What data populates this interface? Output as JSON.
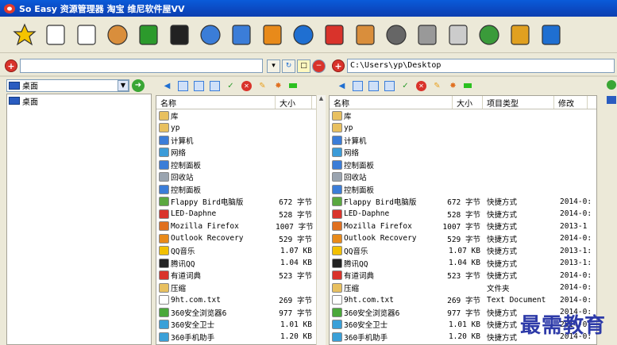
{
  "window": {
    "title": "So Easy 资源管理器  淘宝 维尼软件屋VV"
  },
  "toolbar": {
    "buttons": [
      {
        "icon": "star-icon",
        "color": "#f5c400"
      },
      {
        "icon": "document-icon",
        "color": "#ffffff"
      },
      {
        "icon": "edit-icon",
        "color": "#ffffff"
      },
      {
        "icon": "palette-icon",
        "color": "#d98e3c"
      },
      {
        "icon": "notepad-icon",
        "color": "#2c9a2c"
      },
      {
        "icon": "cmd-icon",
        "color": "#222222"
      },
      {
        "icon": "monitor-icon",
        "color": "#3b7dd8"
      },
      {
        "icon": "users-icon",
        "color": "#3b7dd8"
      },
      {
        "icon": "folder-icon",
        "color": "#e88a1a"
      },
      {
        "icon": "ie-icon",
        "color": "#1f6fd1"
      },
      {
        "icon": "home-icon",
        "color": "#d9332b"
      },
      {
        "icon": "recycle-icon",
        "color": "#d98e3c"
      },
      {
        "icon": "film-icon",
        "color": "#666666"
      },
      {
        "icon": "camera-icon",
        "color": "#999999"
      },
      {
        "icon": "clipboard-icon",
        "color": "#cccccc"
      },
      {
        "icon": "windows-icon",
        "color": "#3a9b3a"
      },
      {
        "icon": "alarm-icon",
        "color": "#e0a020"
      },
      {
        "icon": "help-icon",
        "color": "#1f6fd1"
      }
    ]
  },
  "left_address": {
    "value": ""
  },
  "right_address": {
    "value": "C:\\Users\\yp\\Desktop"
  },
  "tree": {
    "combo_value": "桌面",
    "items": [
      {
        "label": "桌面"
      }
    ]
  },
  "left_pane": {
    "columns": [
      "名称",
      "大小"
    ],
    "rows": [
      {
        "name": "库",
        "size": "",
        "color": "#e8c060"
      },
      {
        "name": "yp",
        "size": "",
        "color": "#e8c060"
      },
      {
        "name": "计算机",
        "size": "",
        "color": "#3b7dd8"
      },
      {
        "name": "网络",
        "size": "",
        "color": "#3b9bd8"
      },
      {
        "name": "控制面板",
        "size": "",
        "color": "#3b7dd8"
      },
      {
        "name": "回收站",
        "size": "",
        "color": "#9aa4b0"
      },
      {
        "name": "控制面板",
        "size": "",
        "color": "#3b7dd8"
      },
      {
        "name": "Flappy Bird电脑版",
        "size": "672 字节",
        "color": "#5aa840"
      },
      {
        "name": "LED-Daphne",
        "size": "528 字节",
        "color": "#d9332b"
      },
      {
        "name": "Mozilla Firefox",
        "size": "1007 字节",
        "color": "#e07020"
      },
      {
        "name": "Outlook Recovery",
        "size": "529 字节",
        "color": "#e88a1a"
      },
      {
        "name": "QQ音乐",
        "size": "1.07 KB",
        "color": "#f2c000"
      },
      {
        "name": "腾讯QQ",
        "size": "1.04 KB",
        "color": "#222222"
      },
      {
        "name": "有道词典",
        "size": "523 字节",
        "color": "#d9332b"
      },
      {
        "name": "压缩",
        "size": "",
        "color": "#e8c060"
      },
      {
        "name": "9ht.com.txt",
        "size": "269 字节",
        "color": "#ffffff"
      },
      {
        "name": "360安全浏览器6",
        "size": "977 字节",
        "color": "#4aa83a"
      },
      {
        "name": "360安全卫士",
        "size": "1.01 KB",
        "color": "#3aa0d8"
      },
      {
        "name": "360手机助手",
        "size": "1.20 KB",
        "color": "#3aa0d8"
      }
    ]
  },
  "right_pane": {
    "columns": [
      "名称",
      "大小",
      "项目类型",
      "修改"
    ],
    "rows": [
      {
        "name": "库",
        "size": "",
        "type": "",
        "modified": "",
        "color": "#e8c060"
      },
      {
        "name": "yp",
        "size": "",
        "type": "",
        "modified": "",
        "color": "#e8c060"
      },
      {
        "name": "计算机",
        "size": "",
        "type": "",
        "modified": "",
        "color": "#3b7dd8"
      },
      {
        "name": "网络",
        "size": "",
        "type": "",
        "modified": "",
        "color": "#3b9bd8"
      },
      {
        "name": "控制面板",
        "size": "",
        "type": "",
        "modified": "",
        "color": "#3b7dd8"
      },
      {
        "name": "回收站",
        "size": "",
        "type": "",
        "modified": "",
        "color": "#9aa4b0"
      },
      {
        "name": "控制面板",
        "size": "",
        "type": "",
        "modified": "",
        "color": "#3b7dd8"
      },
      {
        "name": "Flappy Bird电脑版",
        "size": "672 字节",
        "type": "快捷方式",
        "modified": "2014-0:",
        "color": "#5aa840"
      },
      {
        "name": "LED-Daphne",
        "size": "528 字节",
        "type": "快捷方式",
        "modified": "2014-0:",
        "color": "#d9332b"
      },
      {
        "name": "Mozilla Firefox",
        "size": "1007 字节",
        "type": "快捷方式",
        "modified": "2013-1",
        "color": "#e07020"
      },
      {
        "name": "Outlook Recovery",
        "size": "529 字节",
        "type": "快捷方式",
        "modified": "2014-0:",
        "color": "#e88a1a"
      },
      {
        "name": "QQ音乐",
        "size": "1.07 KB",
        "type": "快捷方式",
        "modified": "2013-1:",
        "color": "#f2c000"
      },
      {
        "name": "腾讯QQ",
        "size": "1.04 KB",
        "type": "快捷方式",
        "modified": "2013-1:",
        "color": "#222222"
      },
      {
        "name": "有道词典",
        "size": "523 字节",
        "type": "快捷方式",
        "modified": "2014-0:",
        "color": "#d9332b"
      },
      {
        "name": "压缩",
        "size": "",
        "type": "文件夹",
        "modified": "2014-0:",
        "color": "#e8c060"
      },
      {
        "name": "9ht.com.txt",
        "size": "269 字节",
        "type": "Text Document",
        "modified": "2014-0:",
        "color": "#ffffff"
      },
      {
        "name": "360安全浏览器6",
        "size": "977 字节",
        "type": "快捷方式",
        "modified": "2014-0:",
        "color": "#4aa83a"
      },
      {
        "name": "360安全卫士",
        "size": "1.01 KB",
        "type": "快捷方式",
        "modified": "2014-0:",
        "color": "#3aa0d8"
      },
      {
        "name": "360手机助手",
        "size": "1.20 KB",
        "type": "快捷方式",
        "modified": "2014-0:",
        "color": "#3aa0d8"
      }
    ]
  },
  "watermark": "最需教育"
}
